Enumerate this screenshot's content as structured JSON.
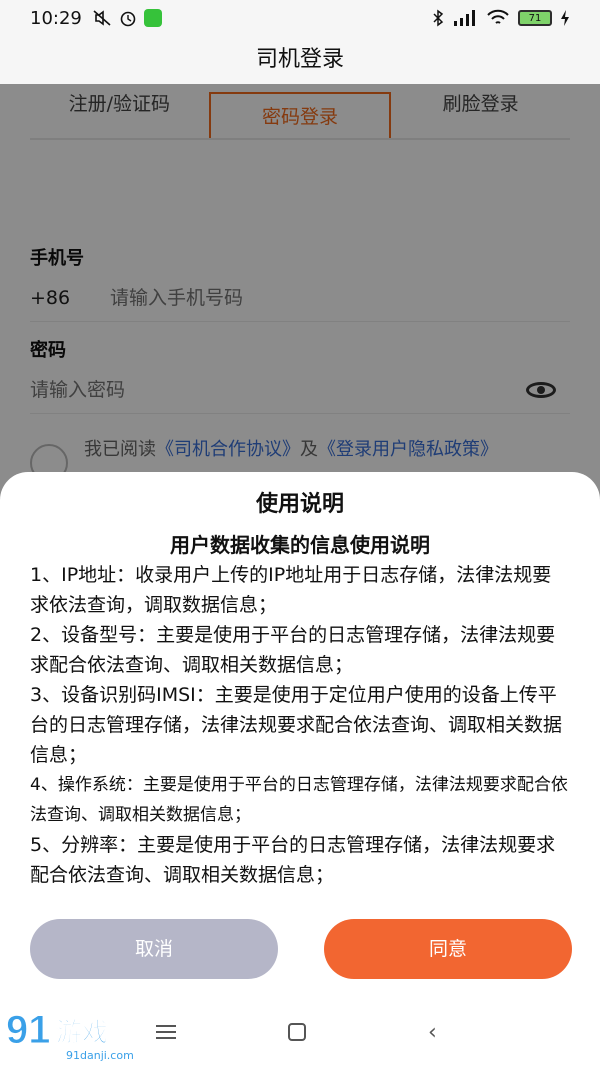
{
  "status_bar": {
    "time": "10:29",
    "battery": "71"
  },
  "title_bar": {
    "title": "司机登录"
  },
  "tabs": [
    {
      "label": "注册/验证码"
    },
    {
      "label": "密码登录"
    },
    {
      "label": "刷脸登录"
    }
  ],
  "form": {
    "phone_label": "手机号",
    "phone_prefix": "+86",
    "phone_placeholder": "请输入手机号码",
    "password_label": "密码",
    "password_placeholder": "请输入密码",
    "agree_text": "我已阅读",
    "agreement_link": "《司机合作协议》",
    "agree_and": "及",
    "privacy_link": "《登录用户隐私政策》"
  },
  "dialog": {
    "title": "使用说明",
    "doc_title": "用户数据收集的信息使用说明",
    "items": [
      "1、IP地址：收录用户上传的IP地址用于日志存储，法律法规要求依法查询，调取数据信息；",
      "2、设备型号：主要是使用于平台的日志管理存储，法律法规要求配合依法查询、调取相关数据信息；",
      "3、设备识别码IMSI：主要是使用于定位用户使用的设备上传平台的日志管理存储，法律法规要求配合依法查询、调取相关数据信息；",
      "4、操作系统：主要是使用于平台的日志管理存储，法律法规要求配合依法查询、调取相关数据信息；",
      "5、分辨率：主要是使用于平台的日志管理存储，法律法规要求配合依法查询、调取相关数据信息；"
    ],
    "cancel_label": "取消",
    "agree_label": "同意"
  },
  "watermark": {
    "brand": "91游戏",
    "url": "91danji.com"
  },
  "colors": {
    "accent": "#f26631",
    "cancel": "#b5b6c8",
    "link": "#3a6fd8"
  }
}
